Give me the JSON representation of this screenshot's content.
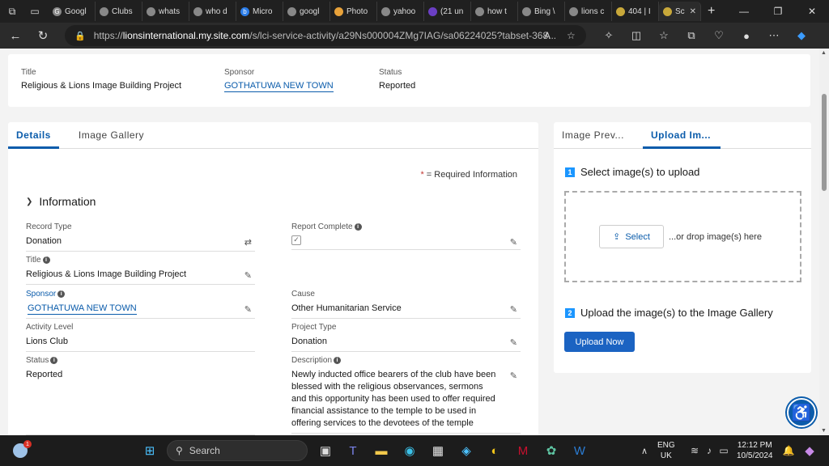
{
  "browser": {
    "tabs": [
      {
        "label": "Googl",
        "icon": "google-icon"
      },
      {
        "label": "Clubs",
        "icon": "globe-icon"
      },
      {
        "label": "whats",
        "icon": "search-icon"
      },
      {
        "label": "who d",
        "icon": "search-icon"
      },
      {
        "label": "Micro",
        "icon": "bing-icon"
      },
      {
        "label": "googl",
        "icon": "search-icon"
      },
      {
        "label": "Photo",
        "icon": "photos-icon"
      },
      {
        "label": "yahoo",
        "icon": "search-icon"
      },
      {
        "label": "(21 un",
        "icon": "mail-icon"
      },
      {
        "label": "how t",
        "icon": "search-icon"
      },
      {
        "label": "Bing \\",
        "icon": "search-icon"
      },
      {
        "label": "lions c",
        "icon": "search-icon"
      },
      {
        "label": "404 | I",
        "icon": "lions-icon"
      }
    ],
    "active_tab": {
      "label": "Sc",
      "close": "✕"
    },
    "new_tab": "+",
    "url_domain": "lionsinternational.my.site.com",
    "url_prefix": "https://",
    "url_path": "/s/lci-service-activity/a29Ns000004ZMg7IAG/sa06224025?tabset-368..."
  },
  "header": {
    "title_label": "Title",
    "title_value": "Religious & Lions Image Building Project",
    "sponsor_label": "Sponsor",
    "sponsor_value": "GOTHATUWA NEW TOWN",
    "status_label": "Status",
    "status_value": "Reported"
  },
  "details": {
    "tabs": [
      "Details",
      "Image Gallery"
    ],
    "required_star": "*",
    "required_text": " = Required Information",
    "section_title": "Information",
    "fields": {
      "record_type": {
        "label": "Record Type",
        "value": "Donation"
      },
      "report_complete": {
        "label": "Report Complete",
        "value": "✓"
      },
      "title": {
        "label": "Title",
        "value": "Religious & Lions Image Building Project"
      },
      "sponsor": {
        "label": "Sponsor",
        "value": "GOTHATUWA NEW TOWN"
      },
      "cause": {
        "label": "Cause",
        "value": "Other Humanitarian Service"
      },
      "activity_level": {
        "label": "Activity Level",
        "value": "Lions Club"
      },
      "project_type": {
        "label": "Project Type",
        "value": "Donation"
      },
      "status": {
        "label": "Status",
        "value": "Reported"
      },
      "description": {
        "label": "Description",
        "value": "Newly inducted office bearers of the club have been blessed with the religious observances, sermons and this opportunity has been used to offer required financial assistance to the temple to be used in offering services to the devotees of the temple"
      }
    }
  },
  "upload": {
    "tabs": [
      "Image Prev...",
      "Upload Im..."
    ],
    "step1_num": "1",
    "step1_text": "Select image(s) to upload",
    "select_label": "Select",
    "drop_text": "...or drop image(s) here",
    "step2_num": "2",
    "step2_text": "Upload the image(s) to the Image Gallery",
    "upload_label": "Upload Now"
  },
  "taskbar": {
    "weather_badge": "1",
    "search_placeholder": "Search",
    "lang_top": "ENG",
    "lang_bottom": "UK",
    "time": "12:12 PM",
    "date": "10/5/2024"
  },
  "colors": {
    "brand": "#0b5cab",
    "upload_button": "#1b63c2",
    "step_badge": "#1b96ff",
    "required": "#c23934"
  }
}
